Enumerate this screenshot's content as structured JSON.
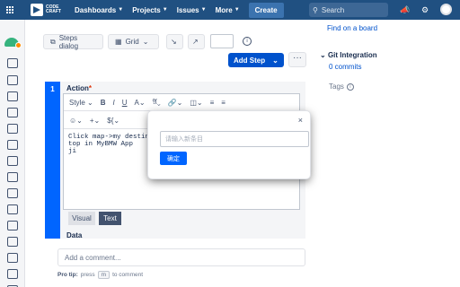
{
  "topnav": {
    "logo_text": "CODE CRAFT",
    "items": [
      {
        "label": "Dashboards"
      },
      {
        "label": "Projects"
      },
      {
        "label": "Issues"
      },
      {
        "label": "More"
      }
    ],
    "create_label": "Create",
    "search_placeholder": "Search"
  },
  "toolbar": {
    "steps_dialog_label": "Steps dialog",
    "grid_label": "Grid",
    "add_step_label": "Add Step",
    "more_label": "···"
  },
  "step": {
    "number": "1",
    "action_label": "Action",
    "required_mark": "*",
    "style_label": "Style",
    "editor_text": "Click map->my destinat\ntop in MyBMW App\nji",
    "tab_visual": "Visual",
    "tab_text": "Text",
    "data_label": "Data"
  },
  "comment": {
    "placeholder": "Add a comment...",
    "protip_label": "Pro tip:",
    "protip_press": "press",
    "protip_key": "m",
    "protip_suffix": "to comment"
  },
  "right_panel": {
    "find_board": "Find on a board",
    "git_title": "Git Integration",
    "git_commits": "0 commits",
    "tags_label": "Tags"
  },
  "modal": {
    "close": "×",
    "input_placeholder": "请输入新条目",
    "ok_label": "确定"
  },
  "colors": {
    "nav_bg": "#205081",
    "primary": "#0052cc",
    "step_accent": "#0065ff"
  }
}
